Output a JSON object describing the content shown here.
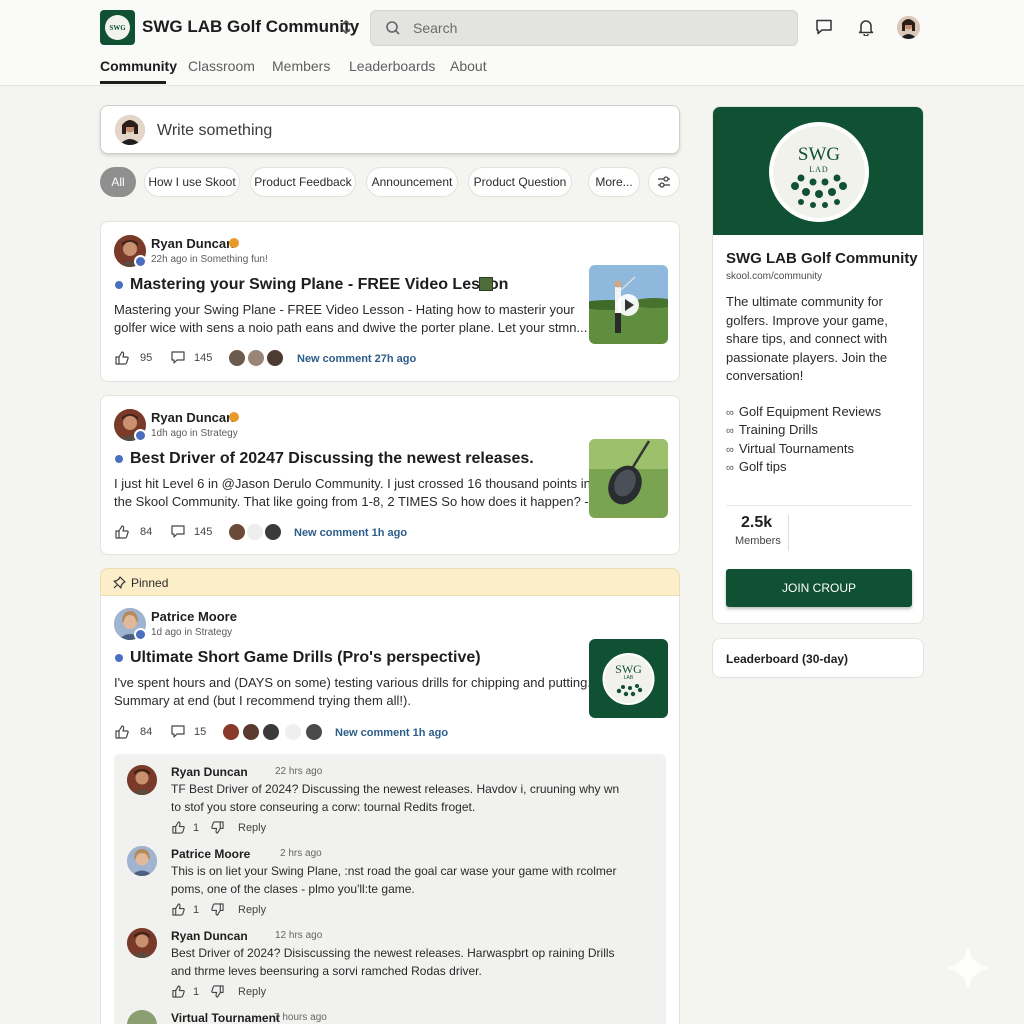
{
  "header": {
    "brand": "SWG LAB Golf Community",
    "logo_text": "SWG",
    "search_placeholder": "Search",
    "nav": [
      "Community",
      "Classroom",
      "Members",
      "Leaderboards",
      "About"
    ]
  },
  "composer": {
    "placeholder": "Write something"
  },
  "filters": [
    "All",
    "How I use Skoot",
    "Product Feedback",
    "Announcement",
    "Product Question",
    "More..."
  ],
  "posts": [
    {
      "author": "Ryan Duncan",
      "meta": "22h ago in Something fun!",
      "title": "Mastering your Swing Plane - FREE Video Lesson",
      "body_1": "Mastering your Swing Plane - FREE Video Lesson - Hating how to masterir your",
      "body_2": "golfer wice with sens a noio path eans and dwive the porter plane. Let your stmn...",
      "likes": "95",
      "comments": "145",
      "new_comment": "New comment 27h ago"
    },
    {
      "author": "Ryan Duncan",
      "meta": "1dh ago in Strategy",
      "title": "Best Driver of 20247 Discussing the newest releases.",
      "body_1": "I just hit Level 6 in @Jason Derulo Community. I just crossed 16 thousand points in",
      "body_2": "the Skool Community. That like going from 1-8, 2 TIMES So how does it happen? -",
      "likes": "84",
      "comments": "145",
      "new_comment": "New comment 1h ago"
    },
    {
      "pinned_label": "Pinned",
      "author": "Patrice Moore",
      "meta": "1d ago in Strategy",
      "title": "Ultimate Short Game Drills (Pro's perspective)",
      "body_1": "I've spent hours and (DAYS on some)  testing various drills for chipping and putting.",
      "body_2": "Summary at end (but I recommend trying them all!).",
      "likes": "84",
      "comments": "15",
      "new_comment": "New comment 1h ago",
      "thumb_text": "SWG",
      "thumb_sub": "LAB"
    }
  ],
  "comments": [
    {
      "name": "Ryan Duncan",
      "time": "22 hrs ago",
      "line_1": "TF Best Driver of 2024? Discussing the newest releases. Havdov i, cruuning why wn",
      "line_2": "to stof you store conseuring a corw: tournal Redits froget.",
      "likes": "1",
      "reply": "Reply"
    },
    {
      "name": "Patrice Moore",
      "time": "2 hrs ago",
      "line_1": "This is on liet your Swing Plane, :nst road the goal car wase your game with rcolmer",
      "line_2": "poms, one of the clases - plmo you'll:te game.",
      "likes": "1",
      "reply": "Reply"
    },
    {
      "name": "Ryan Duncan",
      "time": "12 hrs ago",
      "line_1": "Best Driver of 2024? Disiscussing the newest releases. Harwaspbrt op raining Drills",
      "line_2": "and thrme leves beensuring a sorvi ramched Rodas driver.",
      "likes": "1",
      "reply": "Reply"
    },
    {
      "name": "Virtual Tournament",
      "time": "7 hours ago"
    }
  ],
  "sidebar": {
    "logo_text": "SWG",
    "logo_sub": "LAD",
    "title": "SWG LAB Golf Community",
    "url": "skool.com/community",
    "desc_1": "The ultimate community for",
    "desc_2": "golfers. Improve your game,",
    "desc_3": "share tips, and connect with",
    "desc_4": "passionate players. Join the",
    "desc_5": "conversation!",
    "links": [
      "Golf Equipment Reviews",
      "Training Drills",
      "Virtual Tournaments",
      "Golf tips"
    ],
    "members_count": "2.5k",
    "members_label": "Members",
    "join_label": "JOIN CROUP",
    "leaderboard_label": "Leaderboard (30-day)"
  },
  "colors": {
    "brand_green": "#0f5132",
    "pinned_bg": "#fbeec8",
    "link_blue": "#2d5d8a"
  }
}
